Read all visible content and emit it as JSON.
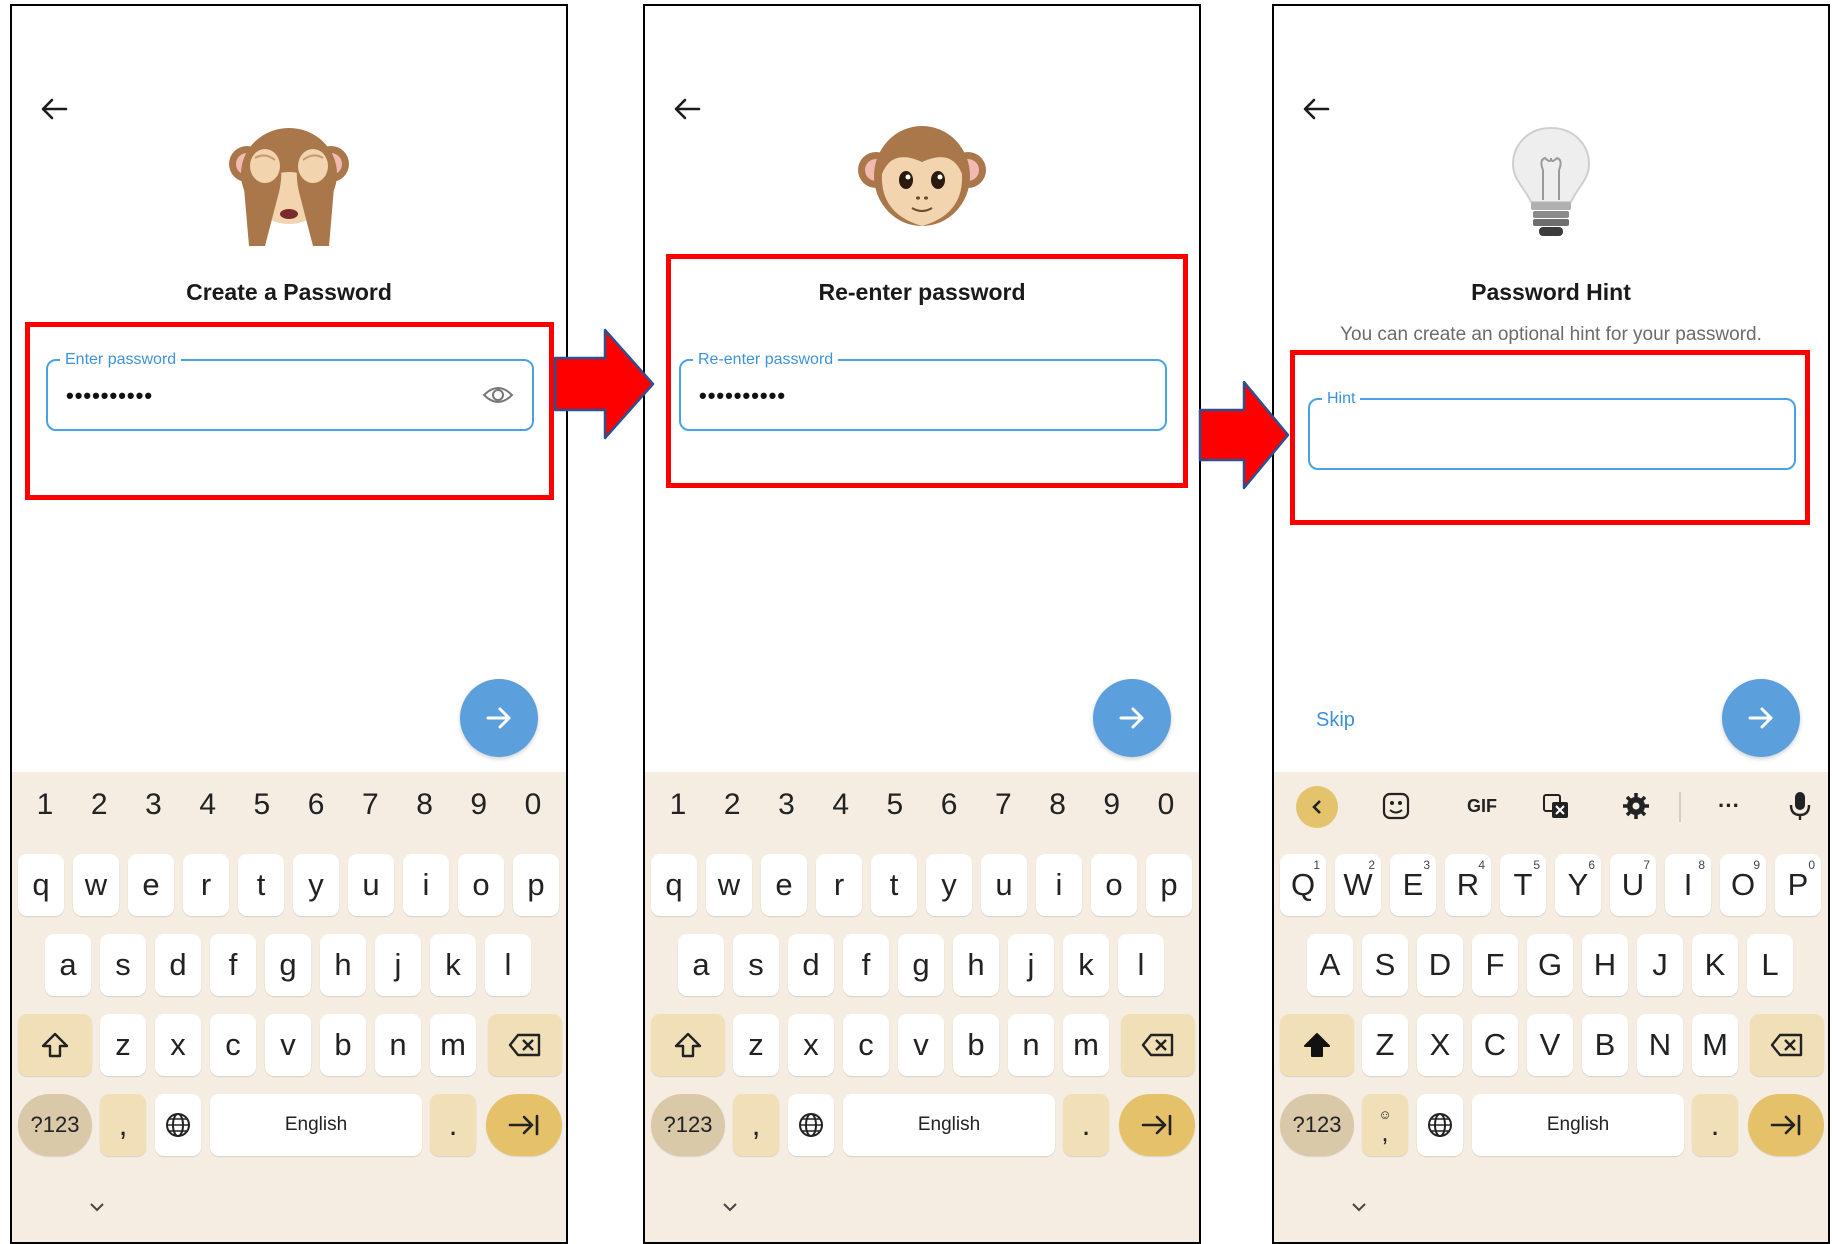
{
  "screens": [
    {
      "title": "Create a Password",
      "field_label": "Enter password",
      "field_value": "••••••••••",
      "hero_icon": "see-no-evil-monkey-icon"
    },
    {
      "title": "Re-enter password",
      "field_label": "Re-enter password",
      "field_value": "••••••••••",
      "hero_icon": "monkey-face-icon"
    },
    {
      "title": "Password Hint",
      "subtitle": "You can create an optional hint for your password.",
      "field_label": "Hint",
      "field_value": "",
      "skip_label": "Skip",
      "hero_icon": "light-bulb-icon"
    }
  ],
  "keyboard": {
    "numbers": [
      "1",
      "2",
      "3",
      "4",
      "5",
      "6",
      "7",
      "8",
      "9",
      "0"
    ],
    "row1": [
      "q",
      "w",
      "e",
      "r",
      "t",
      "y",
      "u",
      "i",
      "o",
      "p"
    ],
    "row2": [
      "a",
      "s",
      "d",
      "f",
      "g",
      "h",
      "j",
      "k",
      "l"
    ],
    "row3": [
      "z",
      "x",
      "c",
      "v",
      "b",
      "n",
      "m"
    ],
    "row1_upper": [
      "Q",
      "W",
      "E",
      "R",
      "T",
      "Y",
      "U",
      "I",
      "O",
      "P"
    ],
    "row1_hints": [
      "1",
      "2",
      "3",
      "4",
      "5",
      "6",
      "7",
      "8",
      "9",
      "0"
    ],
    "row2_upper": [
      "A",
      "S",
      "D",
      "F",
      "G",
      "H",
      "J",
      "K",
      "L"
    ],
    "row3_upper": [
      "Z",
      "X",
      "C",
      "V",
      "B",
      "N",
      "M"
    ],
    "symbols_key": "?123",
    "comma": ",",
    "period": ".",
    "space_label": "English",
    "gif_label": "GIF",
    "more_label": "···"
  },
  "colors": {
    "highlight": "#ff0000",
    "accent": "#4aa1e4",
    "fab": "#5b9fdd",
    "keyboard_bg": "#f5ede1",
    "arrow_fill": "#ff0000",
    "arrow_outline": "#2f4f8f"
  }
}
